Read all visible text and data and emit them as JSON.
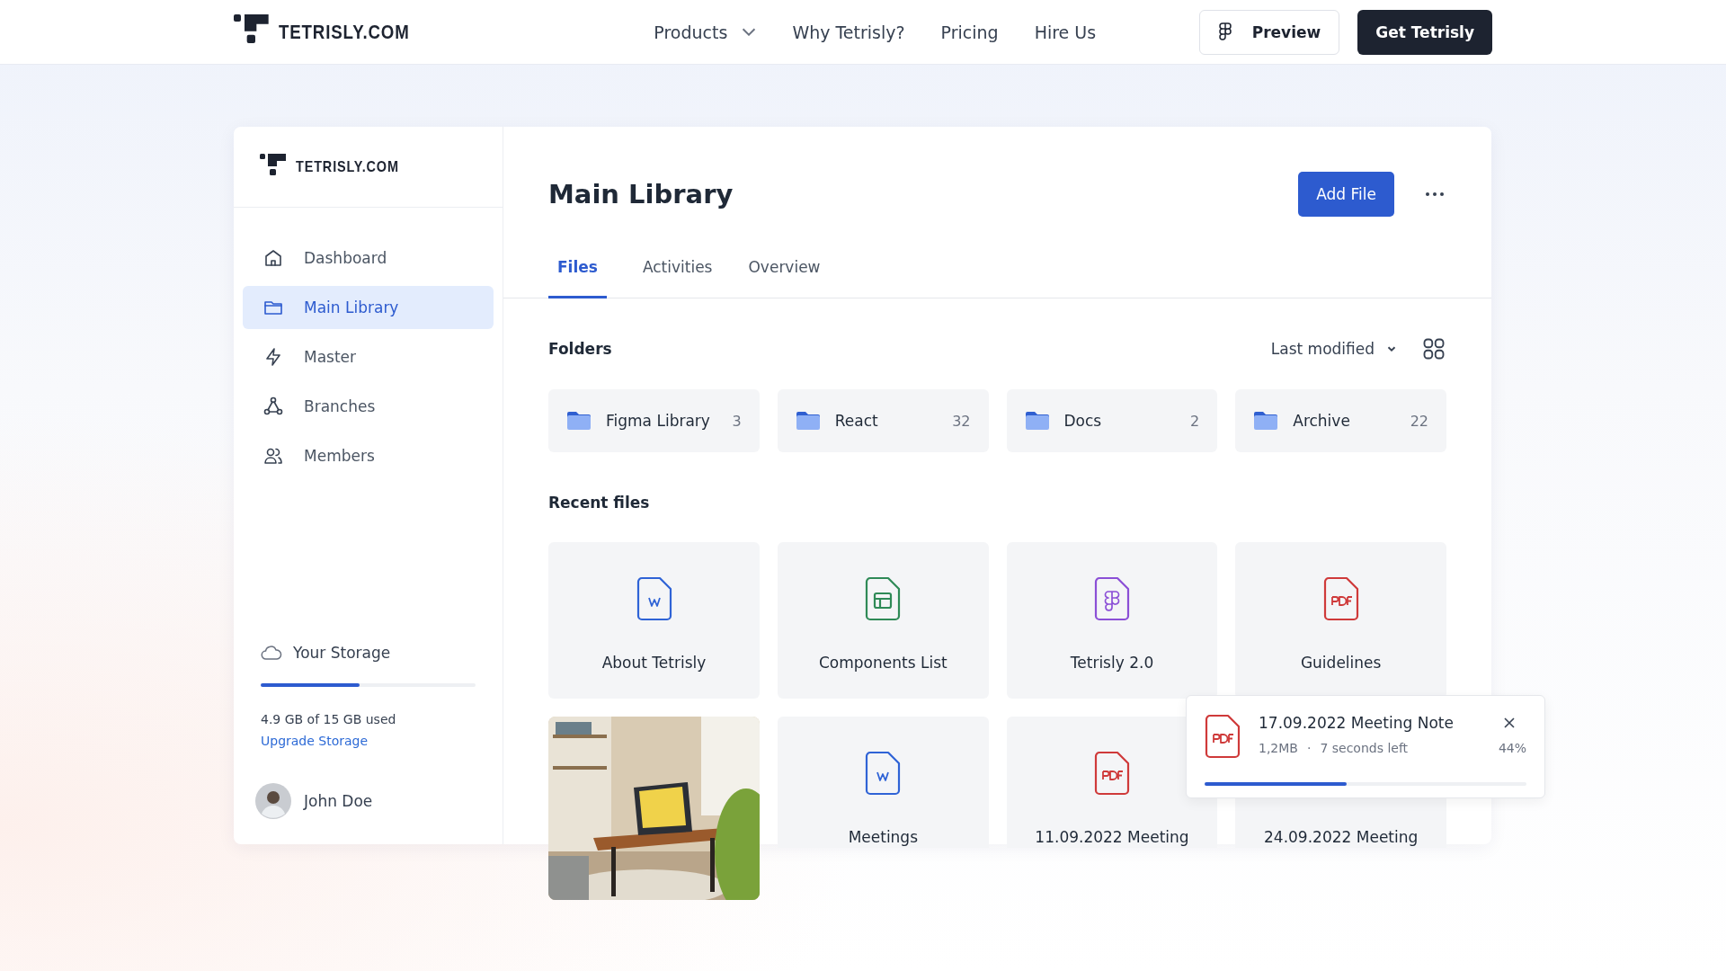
{
  "topbar": {
    "logo": "TETRISLY.COM",
    "links": [
      {
        "label": "Products",
        "dropdown": true
      },
      {
        "label": "Why Tetrisly?",
        "dropdown": false
      },
      {
        "label": "Pricing",
        "dropdown": false
      },
      {
        "label": "Hire Us",
        "dropdown": false
      }
    ],
    "preview_button": "Preview",
    "cta_button": "Get Tetrisly"
  },
  "sidebar": {
    "logo": "TETRISLY.COM",
    "items": [
      {
        "label": "Dashboard",
        "kind": "home",
        "selected": false
      },
      {
        "label": "Main Library",
        "kind": "folder",
        "selected": true
      },
      {
        "label": "Master",
        "kind": "bolt",
        "selected": false
      },
      {
        "label": "Branches",
        "kind": "branches",
        "selected": false
      },
      {
        "label": "Members",
        "kind": "members",
        "selected": false
      }
    ],
    "storage": {
      "title": "Your Storage",
      "level": 0.46,
      "usage": "4.9 GB of 15 GB used",
      "link": "Upgrade Storage"
    },
    "user": {
      "name": "John Doe"
    }
  },
  "main": {
    "title": "Main Library",
    "add_button": "Add File",
    "tabs": [
      {
        "label": "Files",
        "selected": true
      },
      {
        "label": "Activities",
        "selected": false
      },
      {
        "label": "Overview",
        "selected": false
      }
    ],
    "folders_heading": "Folders",
    "sort": "Last modified",
    "folders": [
      {
        "name": "Figma Library",
        "count": "3"
      },
      {
        "name": "React",
        "count": "32"
      },
      {
        "name": "Docs",
        "count": "2"
      },
      {
        "name": "Archive",
        "count": "22"
      }
    ],
    "recent_heading": "Recent files",
    "files": [
      {
        "name": "About Tetrisly",
        "kind": "word"
      },
      {
        "name": "Components List",
        "kind": "sheet"
      },
      {
        "name": "Tetrisly 2.0",
        "kind": "figma"
      },
      {
        "name": "Guidelines",
        "kind": "pdf"
      },
      {
        "kind": "picture"
      },
      {
        "name": "Meetings",
        "kind": "word"
      },
      {
        "name": "11.09.2022 Meeting",
        "kind": "pdf"
      },
      {
        "name": "24.09.2022 Meeting",
        "kind": "covered"
      }
    ]
  },
  "upload": {
    "file": "17.09.2022 Meeting Note",
    "size": "1,2MB",
    "separator": "·",
    "time_left": "7 seconds left",
    "percent": "44%",
    "level": 0.44
  }
}
